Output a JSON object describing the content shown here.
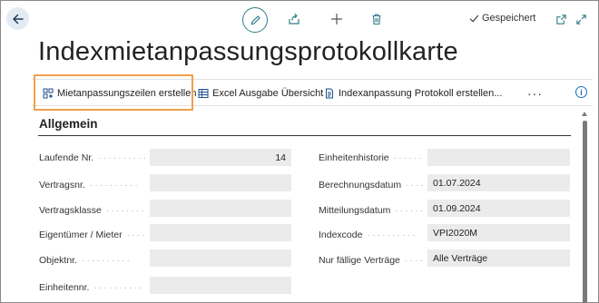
{
  "header": {
    "saved_label": "Gespeichert"
  },
  "page": {
    "title": "Indexmietanpassungsprotokollkarte"
  },
  "actions": [
    {
      "label": "Mietanpassungszeilen erstellen",
      "icon": "create-lines-icon"
    },
    {
      "label": "Excel Ausgabe Übersicht",
      "icon": "excel-table-icon"
    },
    {
      "label": "Indexanpassung Protokoll erstellen...",
      "icon": "document-report-icon"
    }
  ],
  "more_label": "···",
  "section": {
    "title": "Allgemein"
  },
  "left_fields": [
    {
      "label": "Laufende Nr.",
      "value": "14"
    },
    {
      "label": "Vertragsnr.",
      "value": ""
    },
    {
      "label": "Vertragsklasse",
      "value": ""
    },
    {
      "label": "Eigentümer / Mieter",
      "value": ""
    },
    {
      "label": "Objektnr.",
      "value": ""
    },
    {
      "label": "Einheitennr.",
      "value": ""
    }
  ],
  "right_fields": [
    {
      "label": "Einheitenhistorie",
      "value": ""
    },
    {
      "label": "Berechnungsdatum",
      "value": "01.07.2024"
    },
    {
      "label": "Mitteilungsdatum",
      "value": "01.09.2024"
    },
    {
      "label": "Indexcode",
      "value": "VPI2020M"
    },
    {
      "label": "Nur fällige Verträge",
      "value": "Alle Verträge"
    }
  ],
  "colors": {
    "accent": "#2f7d88",
    "highlight": "#f0a04b",
    "field_bg": "#ebebeb"
  }
}
